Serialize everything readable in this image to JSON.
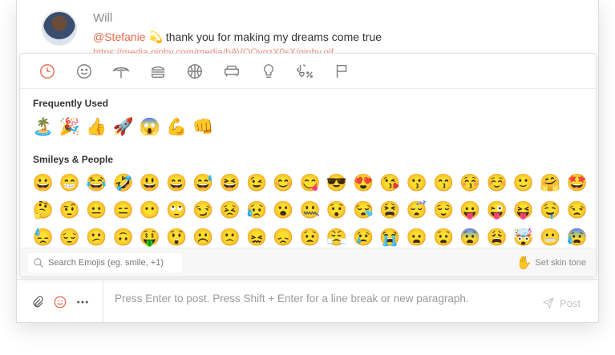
{
  "message": {
    "author": "Will",
    "mention": "@Stefanie",
    "mention_emoji": "💫",
    "text": " thank you for making my dreams come true",
    "link": "https://media.giphy.com/media/bAVQQvgzX0sX/giphy.gif"
  },
  "picker": {
    "categories": [
      "clock-icon",
      "smiley-icon",
      "nature-icon",
      "food-icon",
      "activity-icon",
      "travel-icon",
      "objects-icon",
      "symbols-icon",
      "flags-icon"
    ],
    "frequent_title": "Frequently Used",
    "frequent": [
      "🏝️",
      "🎉",
      "👍",
      "🚀",
      "😱",
      "💪",
      "👊"
    ],
    "smileys_title": "Smileys & People",
    "smileys_row1": [
      "😀",
      "😁",
      "😂",
      "🤣",
      "😃",
      "😄",
      "😅",
      "😆",
      "😉",
      "😊",
      "😋",
      "😎",
      "😍",
      "😘",
      "😗",
      "😙",
      "😚",
      "☺️",
      "🙂",
      "🤗",
      "🤩"
    ],
    "smileys_row2": [
      "🤔",
      "🤨",
      "😐",
      "😑",
      "😶",
      "🙄",
      "😏",
      "😣",
      "😥",
      "😮",
      "🤐",
      "😯",
      "😪",
      "😫",
      "😴",
      "😌",
      "😛",
      "😜",
      "😝",
      "🤤",
      "😒"
    ],
    "smileys_row3": [
      "😓",
      "😔",
      "😕",
      "🙃",
      "🤑",
      "😲",
      "☹️",
      "🙁",
      "😖",
      "😞",
      "😟",
      "😤",
      "😢",
      "😭",
      "😦",
      "😧",
      "😨",
      "😩",
      "🤯",
      "😬",
      "😰"
    ],
    "search_placeholder": "Search Emojis (eg. smile, +1)",
    "skin_label": "Set skin tone",
    "skin_emoji": "✋"
  },
  "composer": {
    "placeholder": "Press Enter to post. Press Shift + Enter for a line break or new paragraph.",
    "post_label": "Post"
  },
  "colors": {
    "accent": "#e8684a",
    "border": "#e4e4e4"
  }
}
